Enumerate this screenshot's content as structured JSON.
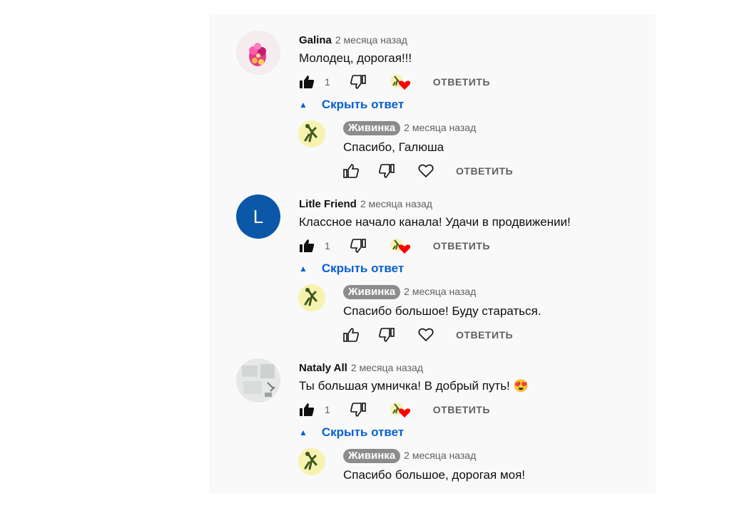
{
  "threads": [
    {
      "author": "Galina",
      "time": "2 месяца назад",
      "text": "Молодец, дорогая!!!",
      "avatar_kind": "flower",
      "likes": "1",
      "reply_label": "ОТВЕТИТЬ",
      "hide_label": "Скрыть ответ",
      "reply": {
        "author": "Живинка",
        "time": "2 месяца назад",
        "text": "Спасибо, Галюша",
        "reply_label": "ОТВЕТИТЬ"
      }
    },
    {
      "author": "Litle Friend",
      "time": "2 месяца назад",
      "text": "Классное начало канала! Удачи в продвижении!",
      "avatar_kind": "letter",
      "avatar_letter": "L",
      "likes": "1",
      "reply_label": "ОТВЕТИТЬ",
      "hide_label": "Скрыть ответ",
      "reply": {
        "author": "Живинка",
        "time": "2 месяца назад",
        "text": "Спасибо большое! Буду стараться.",
        "reply_label": "ОТВЕТИТЬ"
      }
    },
    {
      "author": "Nataly All",
      "time": "2 месяца назад",
      "text": "Ты большая умничка! В добрый путь! 😍",
      "avatar_kind": "photo",
      "likes": "1",
      "reply_label": "ОТВЕТИТЬ",
      "hide_label": "Скрыть ответ",
      "reply": {
        "author": "Живинка",
        "time": "2 месяца назад",
        "text": "Спасибо большое, дорогая моя!",
        "reply_label": "ОТВЕТИТЬ"
      }
    }
  ],
  "colors": {
    "link_blue": "#065fd4",
    "heart_red": "#ff0000",
    "chip_gray": "#8c8c8c",
    "avatar_blue": "#0b57a8"
  },
  "icons": [
    "thumb-up-icon",
    "thumb-down-icon",
    "creator-heart-icon",
    "heart-outline-icon",
    "caret-up-icon"
  ]
}
